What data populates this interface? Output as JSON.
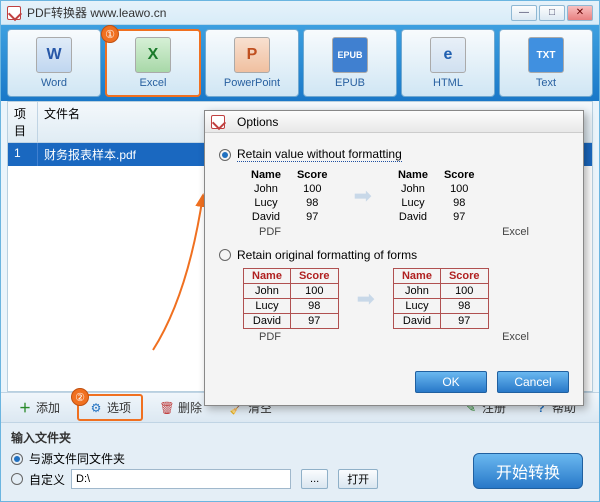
{
  "title": "PDF转换器 www.leawo.cn",
  "toolbar": {
    "items": [
      {
        "label": "Word",
        "glyph": "W"
      },
      {
        "label": "Excel",
        "glyph": "X"
      },
      {
        "label": "PowerPoint",
        "glyph": "P"
      },
      {
        "label": "EPUB",
        "glyph": "EPUB"
      },
      {
        "label": "HTML",
        "glyph": "e"
      },
      {
        "label": "Text",
        "glyph": "TXT"
      }
    ],
    "badge1": "①",
    "badge2": "②"
  },
  "grid": {
    "col_idx": "项目",
    "col_name": "文件名",
    "rows": [
      {
        "idx": "1",
        "name": "财务报表样本.pdf"
      }
    ]
  },
  "actions": {
    "add": "添加",
    "options": "选项",
    "delete": "删除",
    "clear": "清空",
    "register": "注册",
    "help": "帮助"
  },
  "footer": {
    "title": "输入文件夹",
    "opt_same": "与源文件同文件夹",
    "opt_custom": "自定义",
    "path": "D:\\",
    "browse": "...",
    "open": "打开",
    "start": "开始转换"
  },
  "dialog": {
    "title": "Options",
    "opt1": "Retain value without formatting",
    "opt2": "Retain original formatting of forms",
    "hdr_name": "Name",
    "hdr_score": "Score",
    "r1n": "John",
    "r1s": "100",
    "r2n": "Lucy",
    "r2s": "98",
    "r3n": "David",
    "r3s": "97",
    "lbl_pdf": "PDF",
    "lbl_excel": "Excel",
    "ok": "OK",
    "cancel": "Cancel"
  }
}
